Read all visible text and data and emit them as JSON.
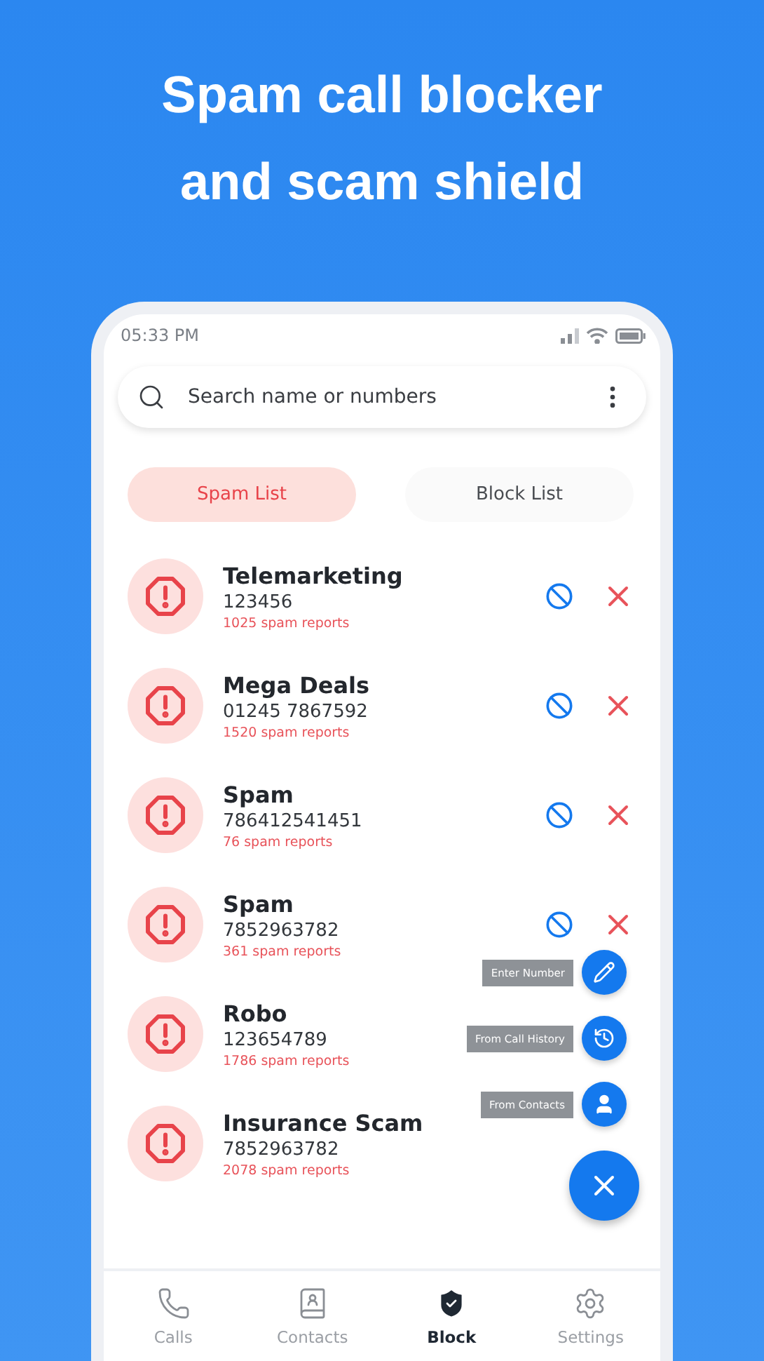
{
  "headline": [
    "Spam call blocker",
    "and scam shield"
  ],
  "status_bar": {
    "time": "05:33 PM"
  },
  "search": {
    "placeholder": "Search name or numbers"
  },
  "tabs": [
    {
      "label": "Spam List",
      "selected": true
    },
    {
      "label": "Block List",
      "selected": false
    }
  ],
  "rows": [
    {
      "name": "Telemarketing",
      "number": "123456",
      "reports": "1025 spam reports",
      "actions": true
    },
    {
      "name": "Mega Deals",
      "number": "01245 7867592",
      "reports": "1520 spam reports",
      "actions": true
    },
    {
      "name": "Spam",
      "number": "786412541451",
      "reports": "76 spam reports",
      "actions": true
    },
    {
      "name": "Spam",
      "number": "7852963782",
      "reports": "361 spam reports",
      "actions": true
    },
    {
      "name": "Robo",
      "number": "123654789",
      "reports": "1786 spam reports",
      "actions": false
    },
    {
      "name": "Insurance Scam",
      "number": "7852963782",
      "reports": "2078 spam reports",
      "actions": false
    }
  ],
  "fab_menu": {
    "expanded": true,
    "items": [
      {
        "label": "Enter Number",
        "kind": "pencil"
      },
      {
        "label": "From Call History",
        "kind": "history"
      },
      {
        "label": "From Contacts",
        "kind": "person"
      }
    ]
  },
  "nav": [
    {
      "label": "Calls",
      "kind": "calls",
      "selected": false
    },
    {
      "label": "Contacts",
      "kind": "contacts",
      "selected": false
    },
    {
      "label": "Block",
      "kind": "block",
      "selected": true
    },
    {
      "label": "Settings",
      "kind": "settings",
      "selected": false
    }
  ]
}
